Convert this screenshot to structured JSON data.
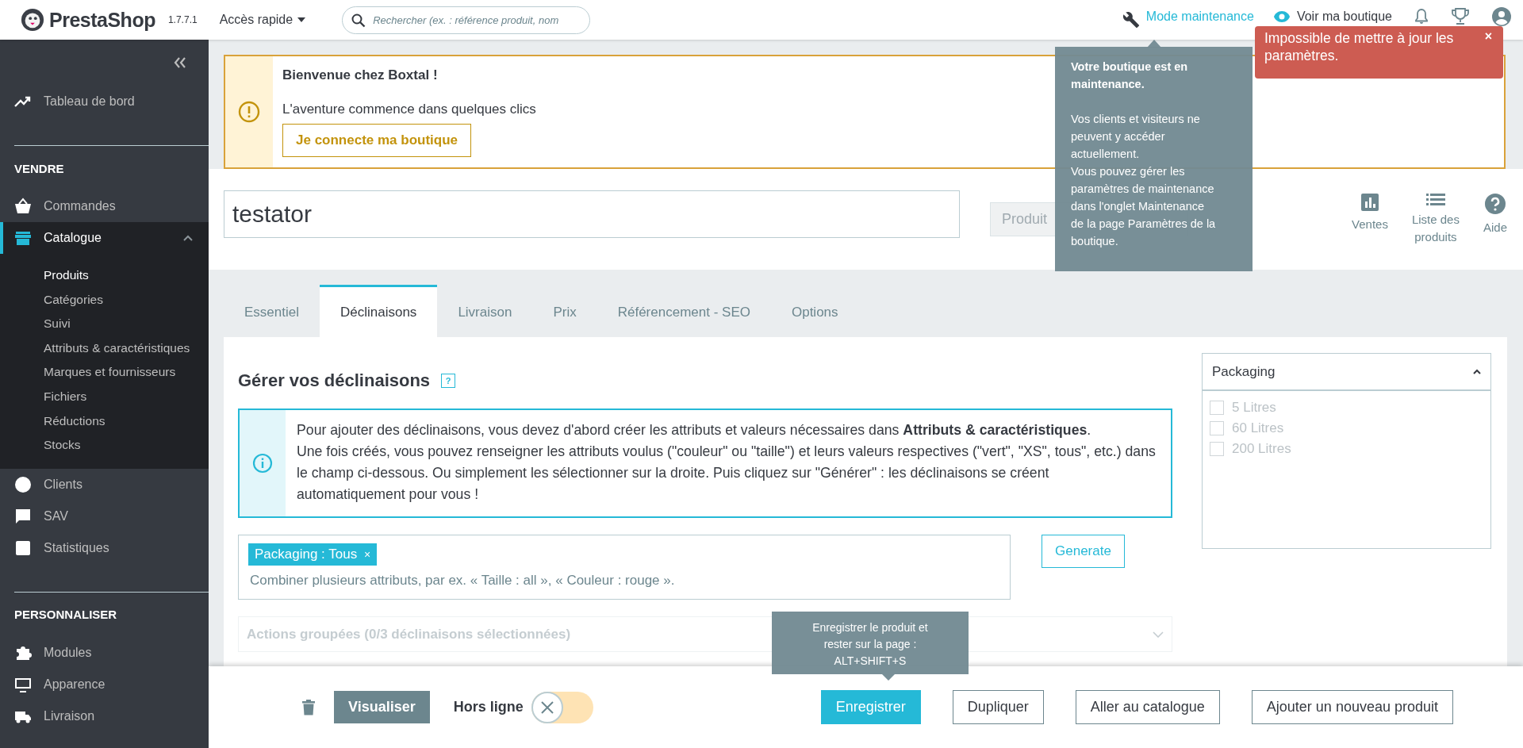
{
  "topbar": {
    "logo": "PrestaShop",
    "version": "1.7.7.1",
    "quick_access": "Accès rapide",
    "search": {
      "placeholder": "Rechercher (ex. : référence produit, nom"
    },
    "maintenance_link": "Mode maintenance",
    "shop_link": "Voir ma boutique"
  },
  "toast": {
    "message": "Impossible de mettre à jour les paramètres.",
    "close": "×"
  },
  "maintenance_tooltip": {
    "title": "Votre boutique est en\nmaintenance.",
    "text": "Vos clients et visiteurs ne\npeuvent y accéder\nactuellement.\nVous pouvez gérer les\nparamètres de maintenance\ndans l'onglet Maintenance\nde la page Paramètres de la\nboutique."
  },
  "sidebar": {
    "top_items": [
      {
        "label": "Tableau de bord"
      }
    ],
    "sections": [
      {
        "heading": "VENDRE",
        "items": [
          {
            "label": "Commandes",
            "selected": false,
            "expanded": false
          },
          {
            "label": "Catalogue",
            "selected": true,
            "expanded": true,
            "children": [
              {
                "label": "Produits",
                "selected": true
              },
              {
                "label": "Catégories",
                "selected": false
              },
              {
                "label": "Suivi",
                "selected": false
              },
              {
                "label": "Attributs & caractéristiques",
                "selected": false
              },
              {
                "label": "Marques et fournisseurs",
                "selected": false
              },
              {
                "label": "Fichiers",
                "selected": false
              },
              {
                "label": "Réductions",
                "selected": false
              },
              {
                "label": "Stocks",
                "selected": false
              }
            ]
          },
          {
            "label": "Clients",
            "selected": false,
            "expanded": false
          },
          {
            "label": "SAV",
            "selected": false,
            "expanded": false
          },
          {
            "label": "Statistiques",
            "selected": false,
            "expanded": false
          }
        ]
      },
      {
        "heading": "PERSONNALISER",
        "items": [
          {
            "label": "Modules",
            "selected": false,
            "expanded": false
          },
          {
            "label": "Apparence",
            "selected": false,
            "expanded": false
          },
          {
            "label": "Livraison",
            "selected": false,
            "expanded": false
          }
        ]
      }
    ]
  },
  "banner": {
    "title": "Bienvenue chez Boxtal !",
    "text": "L'aventure commence dans quelques clics",
    "button": "Je connecte ma boutique"
  },
  "product": {
    "name": "testator",
    "type_field": "Produit",
    "actions": [
      {
        "label": "Ventes"
      },
      {
        "label": "Liste des\nproduits"
      },
      {
        "label": "Aide"
      }
    ]
  },
  "tabs": [
    {
      "label": "Essentiel",
      "selected": false
    },
    {
      "label": "Déclinaisons",
      "selected": true
    },
    {
      "label": "Livraison",
      "selected": false
    },
    {
      "label": "Prix",
      "selected": false
    },
    {
      "label": "Référencement - SEO",
      "selected": false
    },
    {
      "label": "Options",
      "selected": false
    }
  ],
  "combinations": {
    "title": "Gérer vos déclinaisons",
    "help": "?",
    "info": [
      "Pour ajouter des déclinaisons, vous devez d'abord créer les attributs et valeurs nécessaires dans **Attributs & caractéristiques**.",
      "Une fois créés, vous pouvez renseigner les attributs voulus (\"couleur\" ou \"taille\") et leurs valeurs respectives (\"vert\", \"XS\", tous\", etc.) dans le champ ci-dessous. Ou simplement les sélectionner sur la droite. Puis cliquez sur \"Générer\" : les déclinaisons se créent automatiquement pour vous !"
    ],
    "tags": [
      {
        "label": "Packaging : Tous",
        "remove": "×"
      }
    ],
    "attribute_placeholder": "Combiner plusieurs attributs, par ex. « Taille : all », « Couleur : rouge ».",
    "generate": "Generate",
    "bulk_actions": "Actions groupées (0/3 déclinaisons sélectionnées)"
  },
  "attribute_panel": {
    "title": "Packaging",
    "expanded": true,
    "options": [
      {
        "label": "5 Litres",
        "checked": false
      },
      {
        "label": "60 Litres",
        "checked": false
      },
      {
        "label": "200 Litres",
        "checked": false
      }
    ]
  },
  "footer": {
    "preview": "Visualiser",
    "online_label": "Hors ligne",
    "online": false,
    "buttons": [
      {
        "label": "Enregistrer",
        "kind": "primary"
      },
      {
        "label": "Dupliquer",
        "kind": "outline"
      },
      {
        "label": "Aller au catalogue",
        "kind": "outline"
      },
      {
        "label": "Ajouter un nouveau produit",
        "kind": "outline"
      }
    ],
    "save_tooltip": "Enregistrer le produit et\nrester sur la page :\nALT+SHIFT+S"
  }
}
